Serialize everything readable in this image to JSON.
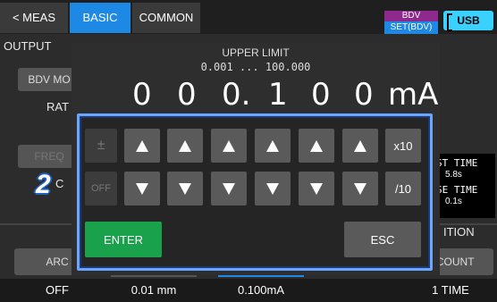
{
  "topbar": {
    "back_label": "< MEAS",
    "basic_label": "BASIC",
    "common_label": "COMMON",
    "bdv_top": "BDV",
    "bdv_bottom": "SET(BDV)",
    "usb_label": "USB"
  },
  "background": {
    "output_label": "OUTPUT",
    "bdv_mode_btn": "BDV MO",
    "rate_label": "RAT",
    "freq_label": "FREQ",
    "c_label": "C",
    "arc_btn": "ARC",
    "condition_label": "ITION",
    "count_btn": "T COUNT",
    "right_time1": "ST TIME",
    "right_time1_val": "5.8s",
    "right_time2": "SE TIME",
    "right_time2_val": "0.1s"
  },
  "bottom_values": [
    "OFF",
    "0.01 mm",
    "0.100mA",
    "1 TIME"
  ],
  "dialog": {
    "title": "UPPER LIMIT",
    "range": "0.001 ... 100.000",
    "digits": [
      "0",
      "0",
      "0.",
      "1",
      "0",
      "0",
      "mA"
    ],
    "plusminus_label": "±",
    "off_label": "OFF",
    "x10_label": "x10",
    "div10_label": "/10",
    "enter_label": "ENTER",
    "esc_label": "ESC"
  },
  "annotation": {
    "step_number": "2"
  },
  "colors": {
    "accent": "#1e88e5",
    "enter": "#1aa14b",
    "focus": "#6aa6ff",
    "usb": "#3bd1ff"
  }
}
